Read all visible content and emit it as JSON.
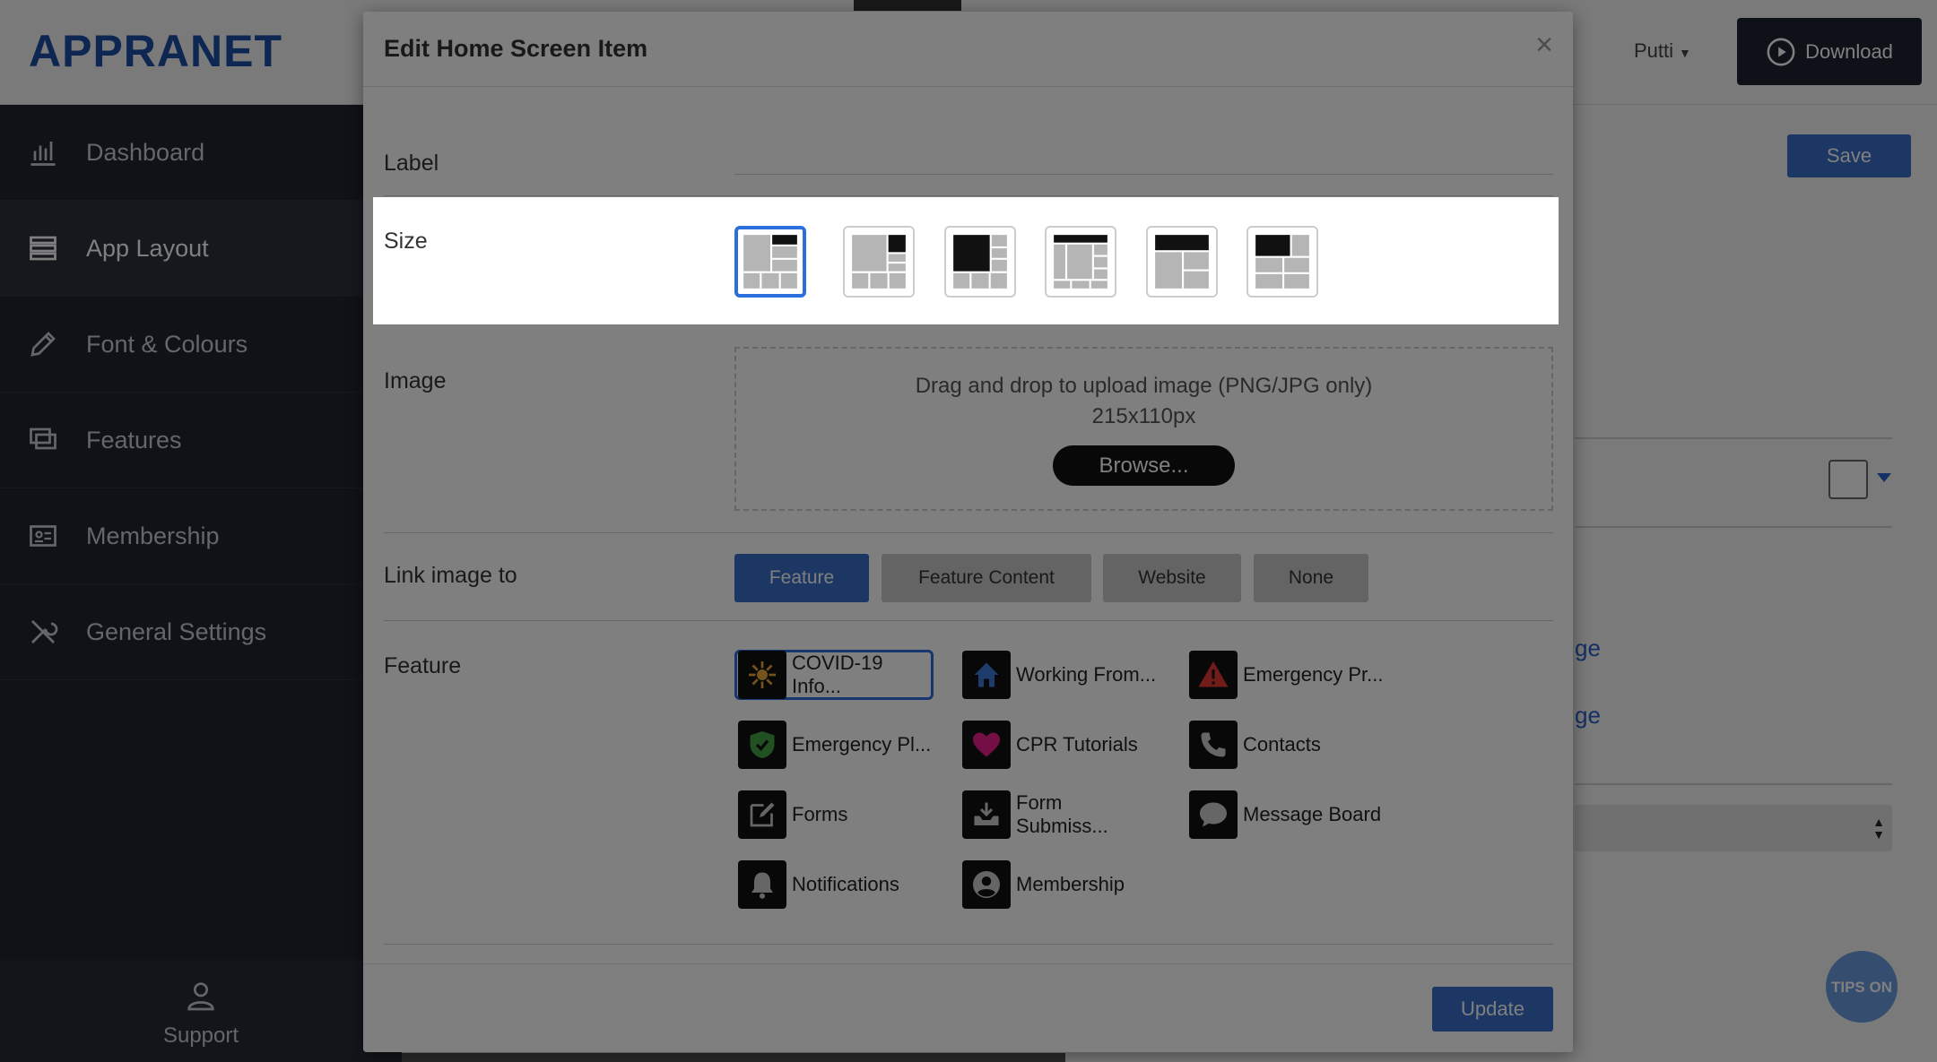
{
  "header": {
    "logo": "APPRANET",
    "user_name": "Putti",
    "download_label": "Download"
  },
  "sidebar": {
    "items": [
      {
        "label": "Dashboard"
      },
      {
        "label": "App Layout"
      },
      {
        "label": "Font & Colours"
      },
      {
        "label": "Features"
      },
      {
        "label": "Membership"
      },
      {
        "label": "General Settings"
      }
    ],
    "support_label": "Support"
  },
  "content": {
    "save_label": "Save",
    "link_fragment_1": "ge",
    "link_fragment_2": "ge",
    "tips_label": "TIPS ON"
  },
  "modal": {
    "title": "Edit Home Screen Item",
    "close_symbol": "×",
    "label_field": {
      "label": "Label",
      "value": ""
    },
    "size": {
      "label": "Size",
      "selected_index": 0,
      "option_count": 6
    },
    "image": {
      "label": "Image",
      "drop_text": "Drag and drop to upload image (PNG/JPG only)",
      "dimensions": "215x110px",
      "browse_label": "Browse..."
    },
    "link_to": {
      "label": "Link image to",
      "options": [
        "Feature",
        "Feature Content",
        "Website",
        "None"
      ],
      "selected": "Feature"
    },
    "feature": {
      "label": "Feature",
      "items": [
        {
          "label": "COVID-19 Info...",
          "icon": "virus-icon",
          "color": "#e8a93a"
        },
        {
          "label": "Working From...",
          "icon": "home-icon",
          "color": "#3b78d8"
        },
        {
          "label": "Emergency Pr...",
          "icon": "warning-icon",
          "color": "#e53935"
        },
        {
          "label": "Emergency Pl...",
          "icon": "shield-check-icon",
          "color": "#43a047"
        },
        {
          "label": "CPR Tutorials",
          "icon": "heart-icon",
          "color": "#e91e8c"
        },
        {
          "label": "Contacts",
          "icon": "phone-icon",
          "color": "#cccccc"
        },
        {
          "label": "Forms",
          "icon": "edit-form-icon",
          "color": "#cccccc"
        },
        {
          "label": "Form Submiss...",
          "icon": "inbox-icon",
          "color": "#cccccc"
        },
        {
          "label": "Message Board",
          "icon": "chat-bubble-icon",
          "color": "#cccccc"
        },
        {
          "label": "Notifications",
          "icon": "bell-icon",
          "color": "#cccccc"
        },
        {
          "label": "Membership",
          "icon": "user-circle-icon",
          "color": "#cccccc"
        }
      ],
      "selected_index": 0
    },
    "update_label": "Update"
  }
}
